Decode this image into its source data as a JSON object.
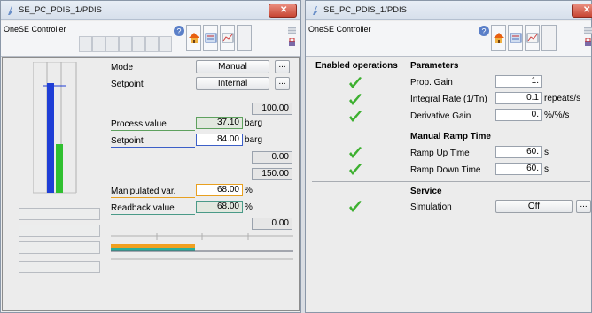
{
  "colors": {
    "bar_blue": "#1f3ed6",
    "bar_green": "#30c030",
    "orange": "#f0a020",
    "teal": "#2ab09a",
    "check_green": "#3db030",
    "close_red": "#c74634"
  },
  "left": {
    "title": "SE_PC_PDIS_1/PDIS",
    "controller": "OneSE Controller",
    "mode_label": "Mode",
    "mode_value": "Manual",
    "setpoint_source_label": "Setpoint",
    "setpoint_source_value": "Internal",
    "dots": "...",
    "range_high": "100.00",
    "pv_label": "Process value",
    "pv_value": "37.10",
    "pv_unit": "barg",
    "sp_label": "Setpoint",
    "sp_value": "84.00",
    "sp_unit": "barg",
    "range_low": "0.00",
    "mv_high": "150.00",
    "mv_label": "Manipulated var.",
    "mv_value": "68.00",
    "mv_unit": "%",
    "rb_label": "Readback value",
    "rb_value": "68.00",
    "rb_unit": "%",
    "mv_low": "0.00",
    "pv_fraction": 0.371,
    "sp_fraction": 0.84,
    "mv_fraction": 0.68
  },
  "right": {
    "title": "SE_PC_PDIS_1/PDIS",
    "controller": "OneSE Controller",
    "enabled_header": "Enabled operations",
    "parameters_header": "Parameters",
    "prop_gain_label": "Prop. Gain",
    "prop_gain_value": "1.",
    "integral_label": "Integral Rate (1/Tn)",
    "integral_value": "0.1",
    "integral_unit": "repeats/s",
    "derivative_label": "Derivative Gain",
    "derivative_value": "0.",
    "derivative_unit": "%/%/s",
    "ramp_header": "Manual Ramp Time",
    "ramp_up_label": "Ramp Up Time",
    "ramp_up_value": "60.",
    "ramp_up_unit": "s",
    "ramp_down_label": "Ramp Down Time",
    "ramp_down_value": "60.",
    "ramp_down_unit": "s",
    "service_header": "Service",
    "simulation_label": "Simulation",
    "simulation_value": "Off",
    "dots": "..."
  }
}
